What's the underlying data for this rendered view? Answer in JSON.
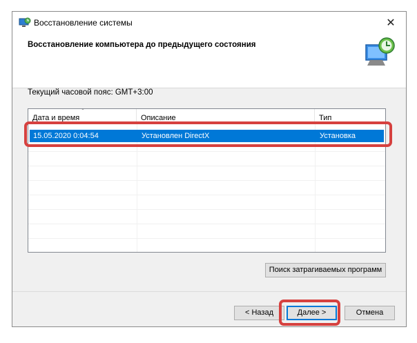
{
  "window": {
    "title": "Восстановление системы",
    "close_icon": "close-icon"
  },
  "header": {
    "title": "Восстановление компьютера до предыдущего состояния",
    "icon": "system-restore-icon"
  },
  "timezone_label": "Текущий часовой пояс: GMT+3:00",
  "list": {
    "columns": [
      "Дата и время",
      "Описание",
      "Тип"
    ],
    "rows": [
      {
        "datetime": "15.05.2020 0:04:54",
        "description": "Установлен DirectX",
        "type": "Установка",
        "selected": true
      }
    ]
  },
  "buttons": {
    "scan": "Поиск затрагиваемых программ",
    "back": "< Назад",
    "next": "Далее >",
    "cancel": "Отмена"
  },
  "colors": {
    "selection": "#0078d7",
    "highlight": "#d6413f"
  }
}
